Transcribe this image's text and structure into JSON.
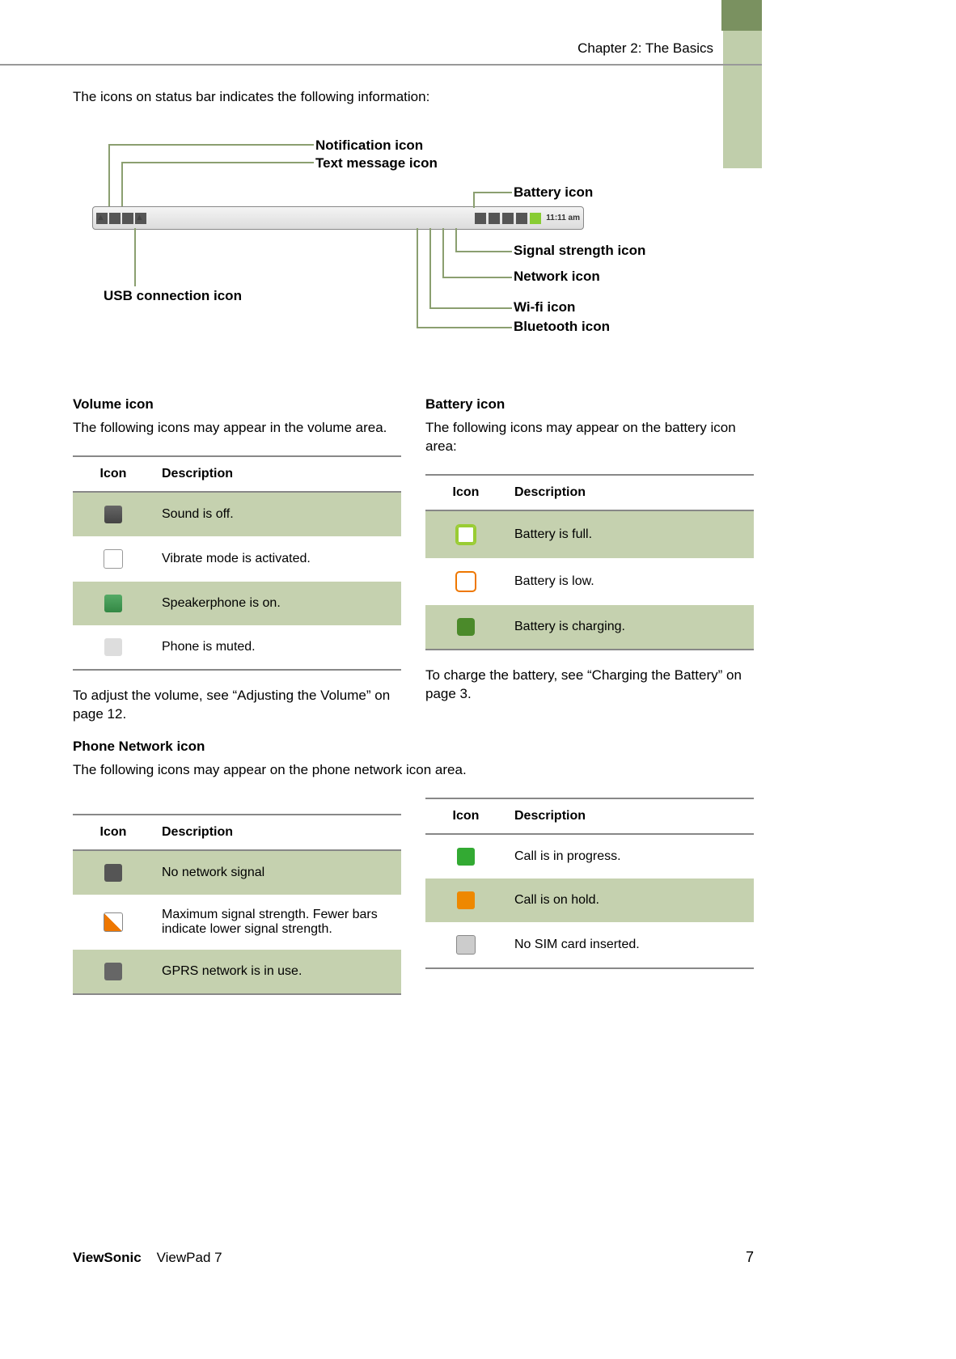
{
  "header": {
    "chapter": "Chapter 2: The Basics"
  },
  "intro": "The icons on status bar indicates the following information:",
  "status_bar": {
    "time": "11:11 am"
  },
  "diagram_labels": {
    "notification": "Notification icon",
    "text_message": "Text message icon",
    "battery": "Battery icon",
    "signal_strength": "Signal strength icon",
    "network": "Network icon",
    "wifi": "Wi-fi icon",
    "bluetooth": "Bluetooth icon",
    "usb": "USB connection icon"
  },
  "volume": {
    "heading": "Volume icon",
    "desc": "The following icons may appear in the volume area.",
    "th_icon": "Icon",
    "th_desc": "Description",
    "rows": [
      "Sound is off.",
      "Vibrate mode is activated.",
      "Speakerphone is on.",
      "Phone is muted."
    ],
    "after": "To adjust the volume, see “Adjusting the Volume” on page 12."
  },
  "battery": {
    "heading": "Battery icon",
    "desc": "The following icons may appear on the battery icon area:",
    "th_icon": "Icon",
    "th_desc": "Description",
    "rows": [
      "Battery is full.",
      "Battery is low.",
      "Battery is charging."
    ],
    "after": "To charge the battery, see “Charging the Battery” on page 3."
  },
  "phone_network": {
    "heading": "Phone Network icon",
    "desc": "The following icons may appear on the phone network icon area.",
    "left": {
      "th_icon": "Icon",
      "th_desc": "Description",
      "rows": [
        "No network signal",
        "Maximum signal strength. Fewer bars indicate lower signal strength.",
        "GPRS network is in use."
      ]
    },
    "right": {
      "th_icon": "Icon",
      "th_desc": "Description",
      "rows": [
        "Call is in progress.",
        "Call is on hold.",
        "No SIM card inserted."
      ]
    }
  },
  "footer": {
    "brand": "ViewSonic",
    "product": "ViewPad 7",
    "page": "7"
  }
}
